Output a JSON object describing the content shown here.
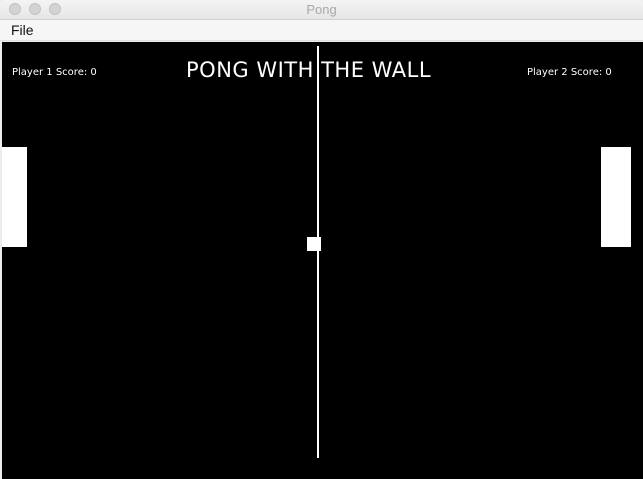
{
  "window": {
    "title": "Pong"
  },
  "menu": {
    "file_label": "File"
  },
  "game": {
    "headline": "PONG WITH THE WALL",
    "player1_score_text": "Player 1 Score: 0",
    "player2_score_text": "Player 2 Score: 0",
    "player1_score": 0,
    "player2_score": 0
  },
  "colors": {
    "court": "#000000",
    "foreground": "#ffffff"
  }
}
